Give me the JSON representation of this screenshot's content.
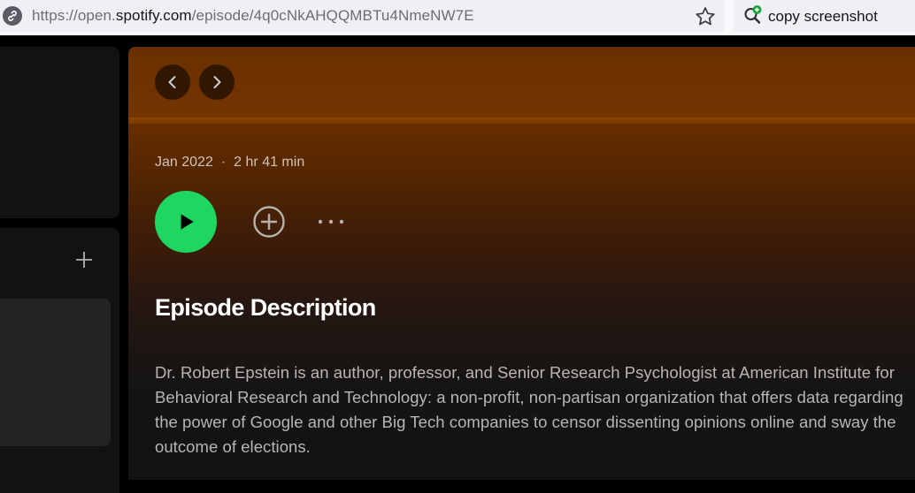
{
  "browser": {
    "url_prefix": "https://open.",
    "url_host": "spotify.com",
    "url_path": "/episode/4q0cNkAHQQMBTu4NmeNW7E",
    "bookmark_icon": "star-icon",
    "extension": {
      "label": "copy screenshot",
      "icon": "magnifier-plus-icon",
      "accent": "#1aa33a"
    }
  },
  "sidebar": {
    "add_icon": "plus-icon"
  },
  "episode": {
    "date": "Jan 2022",
    "separator": "·",
    "duration": "2 hr 41 min",
    "play_icon": "play-icon",
    "add_icon": "plus-circle-icon",
    "more_icon": "more-dots-icon",
    "description_heading": "Episode Description",
    "description": "Dr. Robert Epstein is an author, professor, and Senior Research Psychologist at American Institute for Behavioral Research and Technology: a non-profit, non-partisan organization that offers data regarding the power of Google and other Big Tech companies to censor dissenting opinions online and sway the outcome of elections."
  },
  "colors": {
    "spotify_green": "#1ed760",
    "header_gradient_top": "#733400",
    "background": "#121212"
  }
}
